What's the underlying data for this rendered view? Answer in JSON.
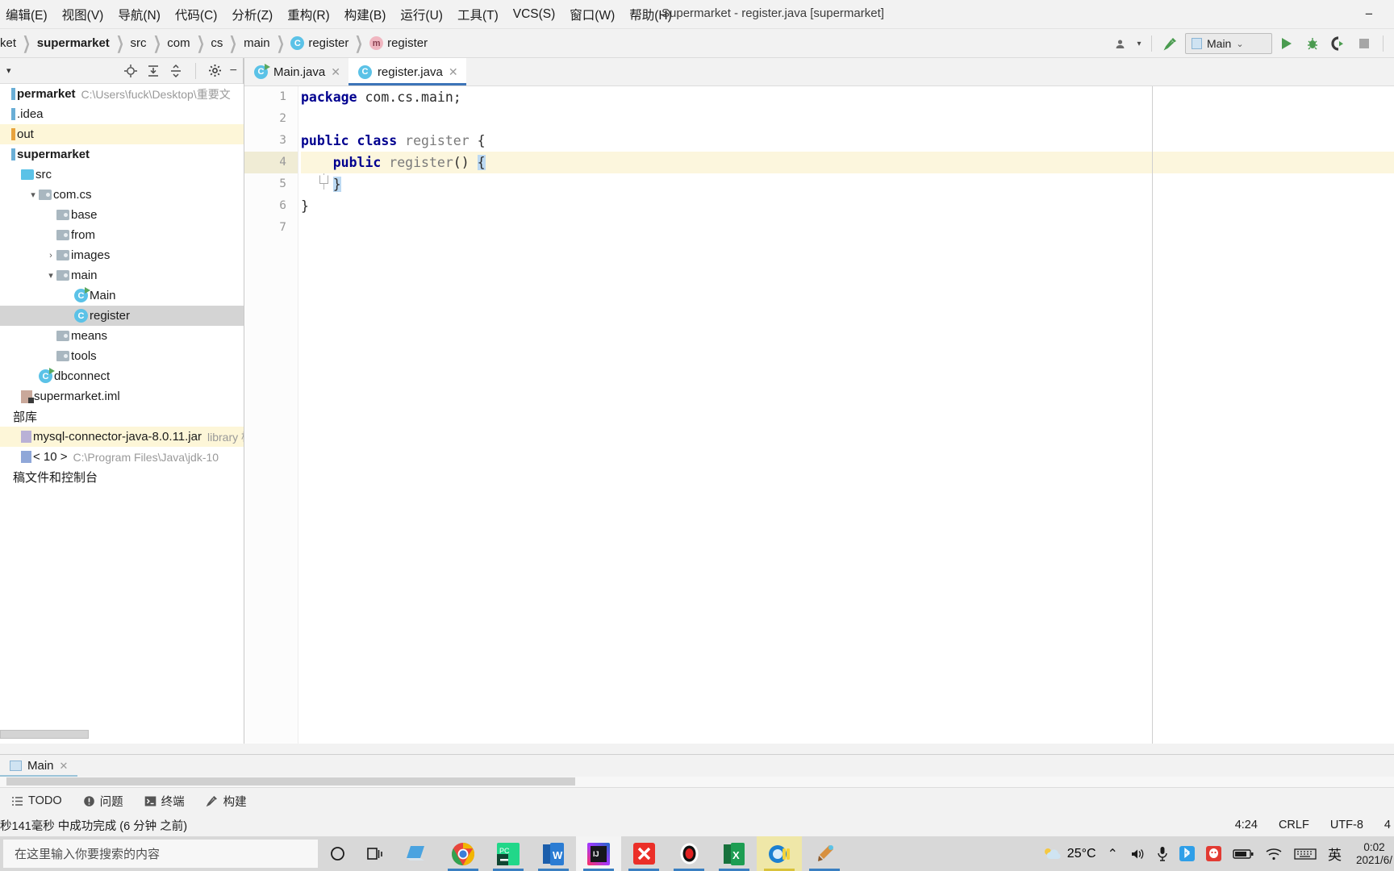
{
  "window": {
    "title": "Supermarket - register.java [supermarket]",
    "minimize_label": "−"
  },
  "menubar": {
    "items": [
      {
        "label": "编辑(E)",
        "name": "menu-edit"
      },
      {
        "label": "视图(V)",
        "name": "menu-view"
      },
      {
        "label": "导航(N)",
        "name": "menu-navigate"
      },
      {
        "label": "代码(C)",
        "name": "menu-code"
      },
      {
        "label": "分析(Z)",
        "name": "menu-analyze"
      },
      {
        "label": "重构(R)",
        "name": "menu-refactor"
      },
      {
        "label": "构建(B)",
        "name": "menu-build"
      },
      {
        "label": "运行(U)",
        "name": "menu-run"
      },
      {
        "label": "工具(T)",
        "name": "menu-tools"
      },
      {
        "label": "VCS(S)",
        "name": "menu-vcs"
      },
      {
        "label": "窗口(W)",
        "name": "menu-window"
      },
      {
        "label": "帮助(H)",
        "name": "menu-help"
      }
    ]
  },
  "breadcrumb": {
    "items": [
      {
        "label": "ket",
        "kind": "text",
        "bold": false
      },
      {
        "label": "supermarket",
        "kind": "text",
        "bold": true
      },
      {
        "label": "src",
        "kind": "text",
        "bold": false
      },
      {
        "label": "com",
        "kind": "text",
        "bold": false
      },
      {
        "label": "cs",
        "kind": "text",
        "bold": false
      },
      {
        "label": "main",
        "kind": "text",
        "bold": false
      },
      {
        "label": "register",
        "kind": "class",
        "badge": "C",
        "bold": false
      },
      {
        "label": "register",
        "kind": "method",
        "badge": "m",
        "bold": false
      }
    ]
  },
  "toolbar": {
    "run_config": "Main",
    "run_config_chevron": "⌄",
    "profile_icon": "profiler-icon",
    "build_icon": "hammer-icon",
    "run_icon": "run-icon",
    "debug_icon": "debug-icon",
    "coverage_icon": "run-coverage-icon",
    "stop_icon": "stop-icon"
  },
  "project_panel": {
    "title_caret": "▾",
    "actions": [
      "locate-icon",
      "expand-all-icon",
      "collapse-all-icon",
      "settings-icon",
      "hide-icon"
    ],
    "tree": [
      {
        "label": "permarket",
        "path": "C:\\Users\\fuck\\Desktop\\重要文",
        "indent": 0,
        "icon": "module",
        "bold": true,
        "arrow": "",
        "state": "normal"
      },
      {
        "label": ".idea",
        "indent": 0,
        "icon": "module-blue",
        "bold": false,
        "arrow": "",
        "state": "normal"
      },
      {
        "label": "out",
        "indent": 0,
        "icon": "module-orange",
        "bold": false,
        "arrow": "",
        "state": "highlight"
      },
      {
        "label": "supermarket",
        "indent": 0,
        "icon": "module-blue",
        "bold": true,
        "arrow": "",
        "state": "normal"
      },
      {
        "label": "src",
        "indent": 1,
        "icon": "folder-src",
        "bold": false,
        "arrow": "",
        "state": "normal"
      },
      {
        "label": "com.cs",
        "indent": 2,
        "icon": "package",
        "bold": false,
        "arrow": "▾",
        "state": "normal"
      },
      {
        "label": "base",
        "indent": 3,
        "icon": "package",
        "bold": false,
        "arrow": "",
        "state": "normal"
      },
      {
        "label": "from",
        "indent": 3,
        "icon": "package",
        "bold": false,
        "arrow": "",
        "state": "normal"
      },
      {
        "label": "images",
        "indent": 3,
        "icon": "package",
        "bold": false,
        "arrow": "›",
        "state": "normal"
      },
      {
        "label": "main",
        "indent": 3,
        "icon": "package",
        "bold": false,
        "arrow": "▾",
        "state": "normal"
      },
      {
        "label": "Main",
        "indent": 4,
        "icon": "class-runnable",
        "bold": false,
        "arrow": "",
        "state": "normal"
      },
      {
        "label": "register",
        "indent": 4,
        "icon": "class",
        "bold": false,
        "arrow": "",
        "state": "selected"
      },
      {
        "label": "means",
        "indent": 3,
        "icon": "package",
        "bold": false,
        "arrow": "",
        "state": "normal"
      },
      {
        "label": "tools",
        "indent": 3,
        "icon": "package",
        "bold": false,
        "arrow": "",
        "state": "normal"
      },
      {
        "label": "dbconnect",
        "indent": 2,
        "icon": "class-runnable",
        "bold": false,
        "arrow": "",
        "state": "normal"
      },
      {
        "label": "supermarket.iml",
        "indent": 1,
        "icon": "iml",
        "bold": false,
        "arrow": "",
        "state": "normal"
      },
      {
        "label": "部库",
        "indent": 0,
        "icon": "none",
        "bold": false,
        "arrow": "",
        "state": "normal"
      },
      {
        "label": "mysql-connector-java-8.0.11.jar",
        "suffix": "library 枢",
        "indent": 1,
        "icon": "jar",
        "bold": false,
        "arrow": "",
        "state": "highlight"
      },
      {
        "label": "< 10 >",
        "path": "C:\\Program Files\\Java\\jdk-10",
        "indent": 1,
        "icon": "jdk",
        "bold": false,
        "arrow": "",
        "state": "normal"
      },
      {
        "label": "稿文件和控制台",
        "indent": 0,
        "icon": "none",
        "bold": false,
        "arrow": "",
        "state": "normal"
      }
    ]
  },
  "editor": {
    "tabs": [
      {
        "label": "Main.java",
        "icon": "java-class-runnable-icon",
        "active": false,
        "close": "✕"
      },
      {
        "label": "register.java",
        "icon": "java-class-icon",
        "active": true,
        "close": "✕"
      }
    ],
    "gutter_lines": [
      "1",
      "2",
      "3",
      "4",
      "5",
      "6",
      "7"
    ],
    "lines": [
      {
        "n": 1,
        "highlight": false,
        "tokens": [
          {
            "t": "package",
            "c": "kw"
          },
          {
            "t": " com.cs.main;",
            "c": ""
          }
        ]
      },
      {
        "n": 2,
        "highlight": false,
        "tokens": []
      },
      {
        "n": 3,
        "highlight": false,
        "tokens": [
          {
            "t": "public class",
            "c": "kw"
          },
          {
            "t": " ",
            "c": ""
          },
          {
            "t": "register",
            "c": "ident"
          },
          {
            "t": " {",
            "c": ""
          }
        ]
      },
      {
        "n": 4,
        "highlight": true,
        "tokens": [
          {
            "t": "    ",
            "c": ""
          },
          {
            "t": "public",
            "c": "kw"
          },
          {
            "t": " ",
            "c": ""
          },
          {
            "t": "register",
            "c": "ident"
          },
          {
            "t": "() ",
            "c": ""
          },
          {
            "t": "{",
            "c": "sel"
          }
        ]
      },
      {
        "n": 5,
        "highlight": false,
        "tokens": [
          {
            "t": "    ",
            "c": ""
          },
          {
            "t": "}",
            "c": "sel"
          }
        ]
      },
      {
        "n": 6,
        "highlight": false,
        "tokens": [
          {
            "t": "}",
            "c": ""
          }
        ]
      },
      {
        "n": 7,
        "highlight": false,
        "tokens": []
      }
    ]
  },
  "run_panel": {
    "tab_label": "Main",
    "tab_close": "✕",
    "tab_icon": "run-window-icon"
  },
  "status_tabs": [
    {
      "label": "TODO",
      "icon": "todo-icon"
    },
    {
      "label": "问题",
      "icon": "problems-icon"
    },
    {
      "label": "终端",
      "icon": "terminal-icon"
    },
    {
      "label": "构建",
      "icon": "build-icon"
    }
  ],
  "statusbar": {
    "message": "秒141毫秒 中成功完成 (6 分钟 之前)",
    "caret": "4:24",
    "line_separator": "CRLF",
    "encoding": "UTF-8",
    "extra": "4"
  },
  "taskbar": {
    "search_placeholder": "在这里输入你要搜索的内容",
    "cortana_icon": "cortana-circle-icon",
    "taskview_icon": "task-view-icon",
    "apps": [
      {
        "name": "file-explorer",
        "icon": "explorer-icon",
        "running": false,
        "state": "normal"
      },
      {
        "name": "google-chrome",
        "icon": "chrome-icon",
        "running": true,
        "state": "normal"
      },
      {
        "name": "pycharm",
        "icon": "pycharm-icon",
        "running": true,
        "state": "normal"
      },
      {
        "name": "microsoft-word",
        "icon": "word-icon",
        "running": true,
        "state": "normal"
      },
      {
        "name": "intellij-idea",
        "icon": "idea-icon",
        "running": true,
        "state": "active"
      },
      {
        "name": "xmind",
        "icon": "xmind-icon",
        "running": true,
        "state": "normal"
      },
      {
        "name": "screen-recorder",
        "icon": "record-icon",
        "running": true,
        "state": "normal"
      },
      {
        "name": "microsoft-excel",
        "icon": "excel-icon",
        "running": true,
        "state": "normal"
      },
      {
        "name": "media-player",
        "icon": "media-player-icon",
        "running": true,
        "state": "flash"
      },
      {
        "name": "paint",
        "icon": "paint-icon",
        "running": true,
        "state": "normal"
      }
    ],
    "tray": {
      "weather_temp": "25°C",
      "weather_icon": "sun-cloud-icon",
      "chevron": "⌃",
      "icons": [
        "volume-icon",
        "microphone-icon",
        "bluetooth-icon",
        "qq-icon",
        "battery-icon",
        "wifi-icon",
        "keyboard-icon"
      ],
      "ime": "英",
      "clock_time": "0:02",
      "clock_date": "2021/6/"
    }
  },
  "colors": {
    "accent_blue": "#3d74b8",
    "tab_active_underline": "#3d74b8",
    "selection": "#bcd9f2",
    "line_highlight": "#fcf6dd",
    "keyword": "#00008f",
    "run_green": "#4a9b4f"
  }
}
